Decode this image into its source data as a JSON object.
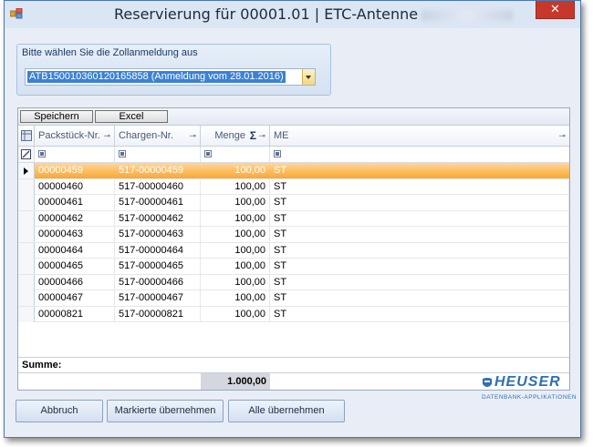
{
  "window": {
    "title": "Reservierung für 00001.01 | ETC-Antenne",
    "close_glyph": "✕"
  },
  "selection_group": {
    "label": "Bitte wählen Sie die Zollanmeldung aus",
    "combo_value": "ATB150010360120165858 (Anmeldung vom 28.01.2016)"
  },
  "toolbar": {
    "save_label": "Speichern",
    "excel_label": "Excel"
  },
  "grid": {
    "columns": [
      "Packstück-Nr.",
      "Chargen-Nr.",
      "Menge",
      "ME"
    ],
    "sigma": "Σ",
    "pin_glyph": "⊸",
    "rows": [
      {
        "packstueck": "00000459",
        "charge": "517-00000459",
        "menge": "100,00",
        "me": "ST",
        "selected": true
      },
      {
        "packstueck": "00000460",
        "charge": "517-00000460",
        "menge": "100,00",
        "me": "ST"
      },
      {
        "packstueck": "00000461",
        "charge": "517-00000461",
        "menge": "100,00",
        "me": "ST"
      },
      {
        "packstueck": "00000462",
        "charge": "517-00000462",
        "menge": "100,00",
        "me": "ST"
      },
      {
        "packstueck": "00000463",
        "charge": "517-00000463",
        "menge": "100,00",
        "me": "ST"
      },
      {
        "packstueck": "00000464",
        "charge": "517-00000464",
        "menge": "100,00",
        "me": "ST"
      },
      {
        "packstueck": "00000465",
        "charge": "517-00000465",
        "menge": "100,00",
        "me": "ST"
      },
      {
        "packstueck": "00000466",
        "charge": "517-00000466",
        "menge": "100,00",
        "me": "ST"
      },
      {
        "packstueck": "00000467",
        "charge": "517-00000467",
        "menge": "100,00",
        "me": "ST"
      },
      {
        "packstueck": "00000821",
        "charge": "517-00000821",
        "menge": "100,00",
        "me": "ST"
      }
    ],
    "summary_label": "Summe:",
    "total_menge": "1.000,00"
  },
  "logo": {
    "word": "HEUSER",
    "sub": "DATENBANK-APPLIKATIONEN",
    "accent_color": "#2f6fb5"
  },
  "buttons": {
    "cancel_label": "Abbruch",
    "apply_selected_label": "Markierte übernehmen",
    "apply_all_label": "Alle übernehmen"
  },
  "colors": {
    "selected_row": "#f7a833",
    "combo_highlight": "#3b82d6",
    "close_button": "#c7382c"
  }
}
